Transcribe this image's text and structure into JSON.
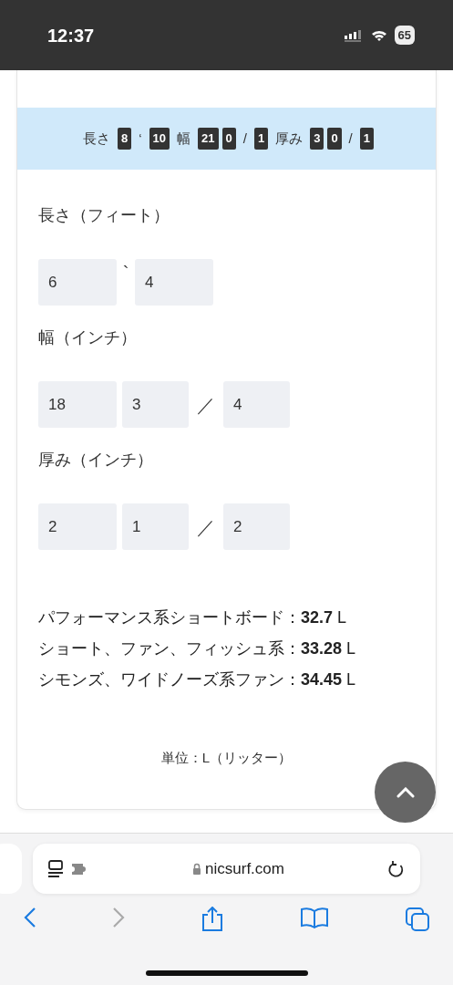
{
  "status_bar": {
    "time": "12:37",
    "battery": "65"
  },
  "summary": [
    {
      "kind": "text",
      "text": "長さ"
    },
    {
      "kind": "badge",
      "text": "8"
    },
    {
      "kind": "text",
      "text": "‘"
    },
    {
      "kind": "badge",
      "text": "10"
    },
    {
      "kind": "text",
      "text": "幅"
    },
    {
      "kind": "badge",
      "text": "21"
    },
    {
      "kind": "badge",
      "text": "0"
    },
    {
      "kind": "text",
      "text": "/"
    },
    {
      "kind": "badge",
      "text": "1"
    },
    {
      "kind": "text",
      "text": "厚み"
    },
    {
      "kind": "badge",
      "text": "3"
    },
    {
      "kind": "badge",
      "text": "0"
    },
    {
      "kind": "text",
      "text": "/"
    },
    {
      "kind": "badge",
      "text": "1"
    }
  ],
  "inputs": [
    {
      "label": "長さ（フィート）",
      "fields": [
        {
          "kind": "field",
          "value": "6"
        },
        {
          "kind": "separator",
          "text": "`"
        },
        {
          "kind": "field",
          "value": "4"
        }
      ]
    },
    {
      "label": "幅（インチ）",
      "fields": [
        {
          "kind": "field",
          "value": "18"
        },
        {
          "kind": "field",
          "value": "3"
        },
        {
          "kind": "separator",
          "text": "／"
        },
        {
          "kind": "field",
          "value": "4"
        }
      ]
    },
    {
      "label": "厚み（インチ）",
      "fields": [
        {
          "kind": "field",
          "value": "2"
        },
        {
          "kind": "field",
          "value": "1"
        },
        {
          "kind": "separator",
          "text": "／"
        },
        {
          "kind": "field",
          "value": "2"
        }
      ]
    }
  ],
  "results": [
    "パフォーマンス系ショートボード：**32.7** L",
    "ショート、ファン、フィッシュ系：**33.28** L",
    "シモンズ、ワイドノーズ系ファン：**34.45** L"
  ],
  "unit_note": "単位：L（リッター）",
  "browser": {
    "url": "nicsurf.com"
  }
}
